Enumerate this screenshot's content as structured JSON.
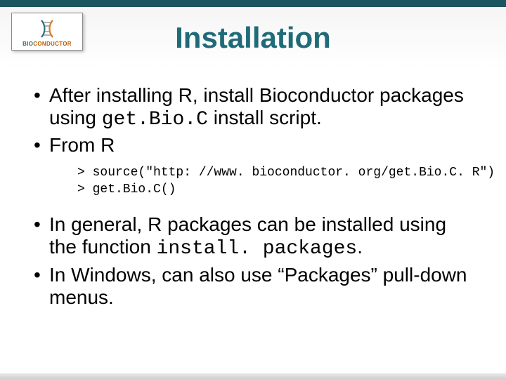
{
  "logo": {
    "name_a": "BIO",
    "name_b": "CONDUCTOR"
  },
  "title": "Installation",
  "bullets": {
    "b1_pre": "After installing R, install Bioconductor packages using ",
    "b1_code": "get.Bio.C",
    "b1_post": " install script.",
    "b2": "From R",
    "b3_pre": "In general, R packages can be installed using the function ",
    "b3_code": "install. packages",
    "b3_post": ".",
    "b4": "In Windows, can also use “Packages” pull-down menus."
  },
  "code": {
    "line1": "> source(\"http: //www. bioconductor. org/get.Bio.C. R\")",
    "line2": "> get.Bio.C()"
  }
}
